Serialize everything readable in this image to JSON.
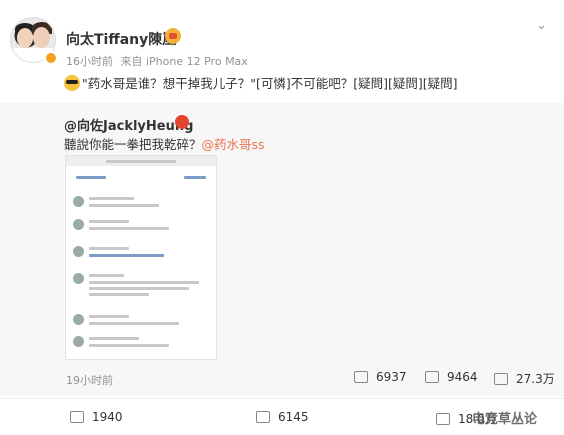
{
  "header": {
    "author": "向太Tiffany陳嵐",
    "time": "16小时前",
    "source": "来自 iPhone 12 Pro Max",
    "more": "⌄"
  },
  "post": {
    "text": "\"药水哥是谁？想干掉我儿子？\"[可憐]不可能吧？[疑問][疑問][疑問]"
  },
  "repost": {
    "author": "@向佐JacklyHeung",
    "text_prefix": "聽說你能一拳把我乾碎？",
    "mention": "@药水哥ss",
    "time": "19小时前",
    "stats": {
      "reposts": "6937",
      "comments": "9464",
      "likes": "27.3万"
    }
  },
  "actions": {
    "reposts": "1940",
    "comments": "6145",
    "likes": "18.0万"
  },
  "watermark": "电竞草丛论",
  "colors": {
    "accent": "#eb7350",
    "meta": "#939393",
    "repost_bg": "#f7f7f7"
  }
}
